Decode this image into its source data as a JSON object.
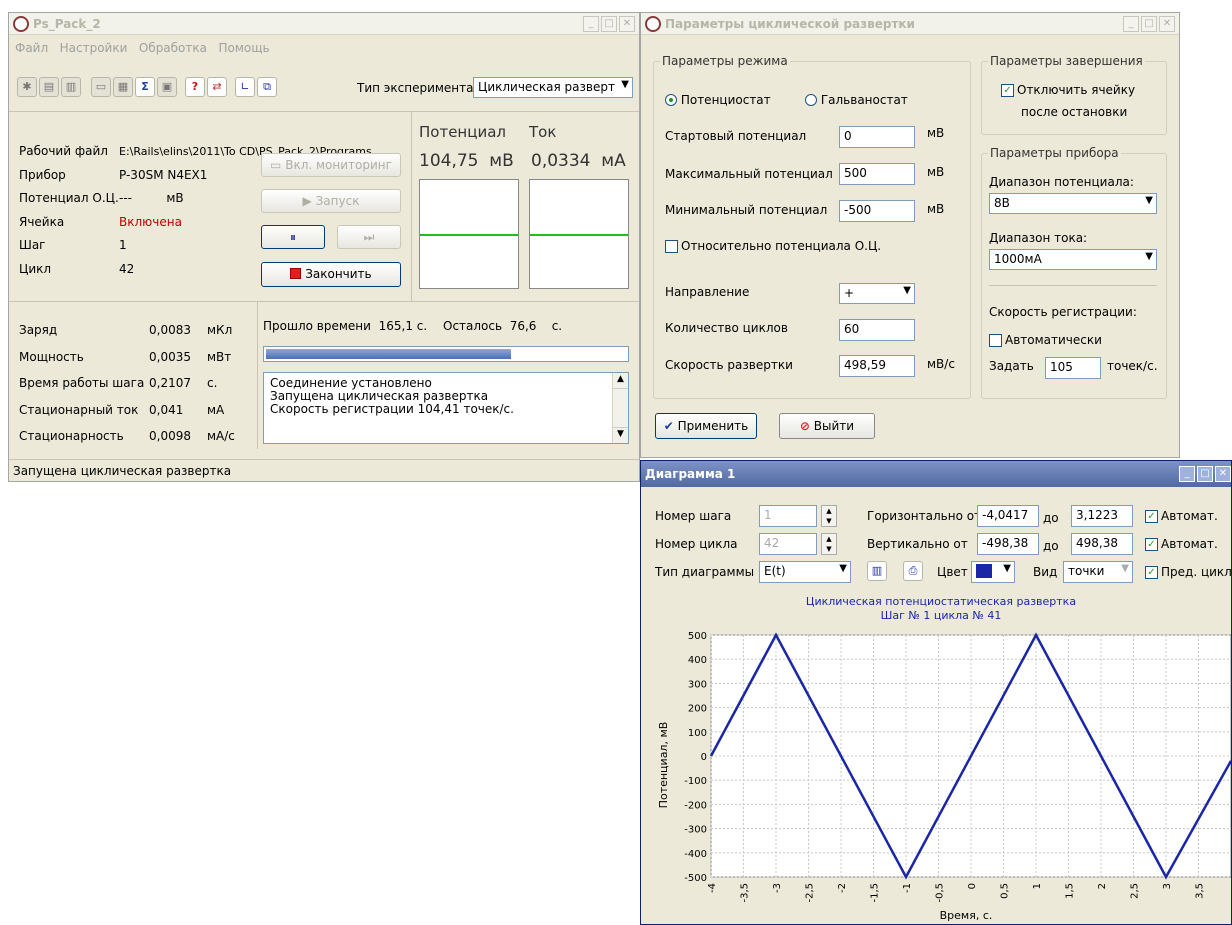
{
  "main": {
    "title": "Ps_Pack_2",
    "menu": [
      "Файл",
      "Настройки",
      "Обработка",
      "Помощь"
    ],
    "experiment_type_label": "Тип эксперимента",
    "experiment_type_value": "Циклическая разверт",
    "info_labels": [
      "Рабочий файл",
      "Прибор",
      "Потенциал О.Ц.",
      "Ячейка",
      "Шаг",
      "Цикл"
    ],
    "info_values": [
      "E:\\Rails\\elins\\2011\\To CD\\PS_Pack_2\\Programs",
      "P-30SM N4EX1",
      "---",
      "Включена",
      "1",
      "42"
    ],
    "potential_unit_oc": "мВ",
    "btn_monitor": "Вкл. мониторинг",
    "btn_start": "Запуск",
    "btn_finish": "Закончить",
    "potential_header": "Потенциал",
    "current_header": "Ток",
    "potential_value": "104,75",
    "potential_unit": "мВ",
    "current_value": "0,0334",
    "current_unit": "мА",
    "stats": [
      {
        "label": "Заряд",
        "value": "0,0083",
        "unit": "мКл"
      },
      {
        "label": "Мощность",
        "value": "0,0035",
        "unit": "мВт"
      },
      {
        "label": "Время работы шага",
        "value": "0,2107",
        "unit": "с."
      },
      {
        "label": "Стационарный ток",
        "value": "0,041",
        "unit": "мА"
      },
      {
        "label": "Стационарность",
        "value": "0,0098",
        "unit": "мА/с"
      }
    ],
    "elapsed_label": "Прошло времени",
    "elapsed_value": "165,1",
    "elapsed_unit": "с.",
    "remain_label": "Осталось",
    "remain_value": "76,6",
    "remain_unit": "с.",
    "progress": 0.68,
    "log": [
      "Соединение установлено",
      "Запущена циклическая развертка",
      "Скорость регистрации 104,41 точек/с."
    ],
    "status": "Запущена циклическая развертка"
  },
  "params": {
    "title": "Параметры циклической развертки",
    "mode_group": "Параметры режима",
    "radio_potentiostat": "Потенциостат",
    "radio_galvanostat": "Гальваностат",
    "start_potential_label": "Стартовый потенциал",
    "start_potential_value": "0",
    "max_potential_label": "Максимальный потенциал",
    "max_potential_value": "500",
    "min_potential_label": "Минимальный потенциал",
    "min_potential_value": "-500",
    "mv": "мВ",
    "relative_oc_label": "Относительно потенциала О.Ц.",
    "direction_label": "Направление",
    "direction_value": "+",
    "cycles_label": "Количество циклов",
    "cycles_value": "60",
    "sweep_rate_label": "Скорость развертки",
    "sweep_rate_value": "498,59",
    "sweep_rate_unit": "мВ/с",
    "finish_group": "Параметры завершения",
    "disconnect_label_1": "Отключить ячейку",
    "disconnect_label_2": "после остановки",
    "device_group": "Параметры прибора",
    "pot_range_label": "Диапазон потенциала:",
    "pot_range_value": "8В",
    "cur_range_label": "Диапазон тока:",
    "cur_range_value": "1000мА",
    "reg_speed_label": "Скорость регистрации:",
    "auto_label": "Автоматически",
    "set_label": "Задать",
    "set_value": "105",
    "points_unit": "точек/с.",
    "apply_button": "Применить",
    "exit_button": "Выйти"
  },
  "diagram": {
    "title": "Диаграмма 1",
    "step_label": "Номер шага",
    "step_value": "1",
    "cycle_label": "Номер цикла",
    "cycle_value": "42",
    "type_label": "Тип диаграммы",
    "type_value": "E(t)",
    "h_from_label": "Горизонтально от",
    "h_from": "-4,0417",
    "h_to_label": "до",
    "h_to": "3,1223",
    "v_from_label": "Вертикально от",
    "v_from": "-498,38",
    "v_to_label": "до",
    "v_to": "498,38",
    "auto_label": "Автомат.",
    "color_label": "Цвет",
    "view_label": "Вид",
    "view_value": "точки",
    "prev_cycle_label": "Пред. цикл",
    "line_color": "#1a26a6"
  },
  "chart_data": {
    "type": "line",
    "title": "Циклическая потенциостатическая развертка",
    "subtitle": "Шаг № 1 цикла № 41",
    "xlabel": "Время, с.",
    "ylabel": "Потенциал, мВ",
    "xlim": [
      -4,
      4
    ],
    "ylim": [
      -500,
      500
    ],
    "xticks": [
      "-4",
      "-3,5",
      "-3",
      "-2,5",
      "-2",
      "-1,5",
      "-1",
      "-0,5",
      "0",
      "0,5",
      "1",
      "1,5",
      "2",
      "2,5",
      "3",
      "3,5"
    ],
    "yticks": [
      "500",
      "400",
      "300",
      "200",
      "100",
      "0",
      "-100",
      "-200",
      "-300",
      "-400",
      "-500"
    ],
    "grid": true,
    "series": [
      {
        "x": [
          -4,
          -3,
          -1,
          1,
          3,
          4
        ],
        "y": [
          0,
          500,
          -500,
          500,
          -500,
          -20
        ]
      }
    ]
  }
}
